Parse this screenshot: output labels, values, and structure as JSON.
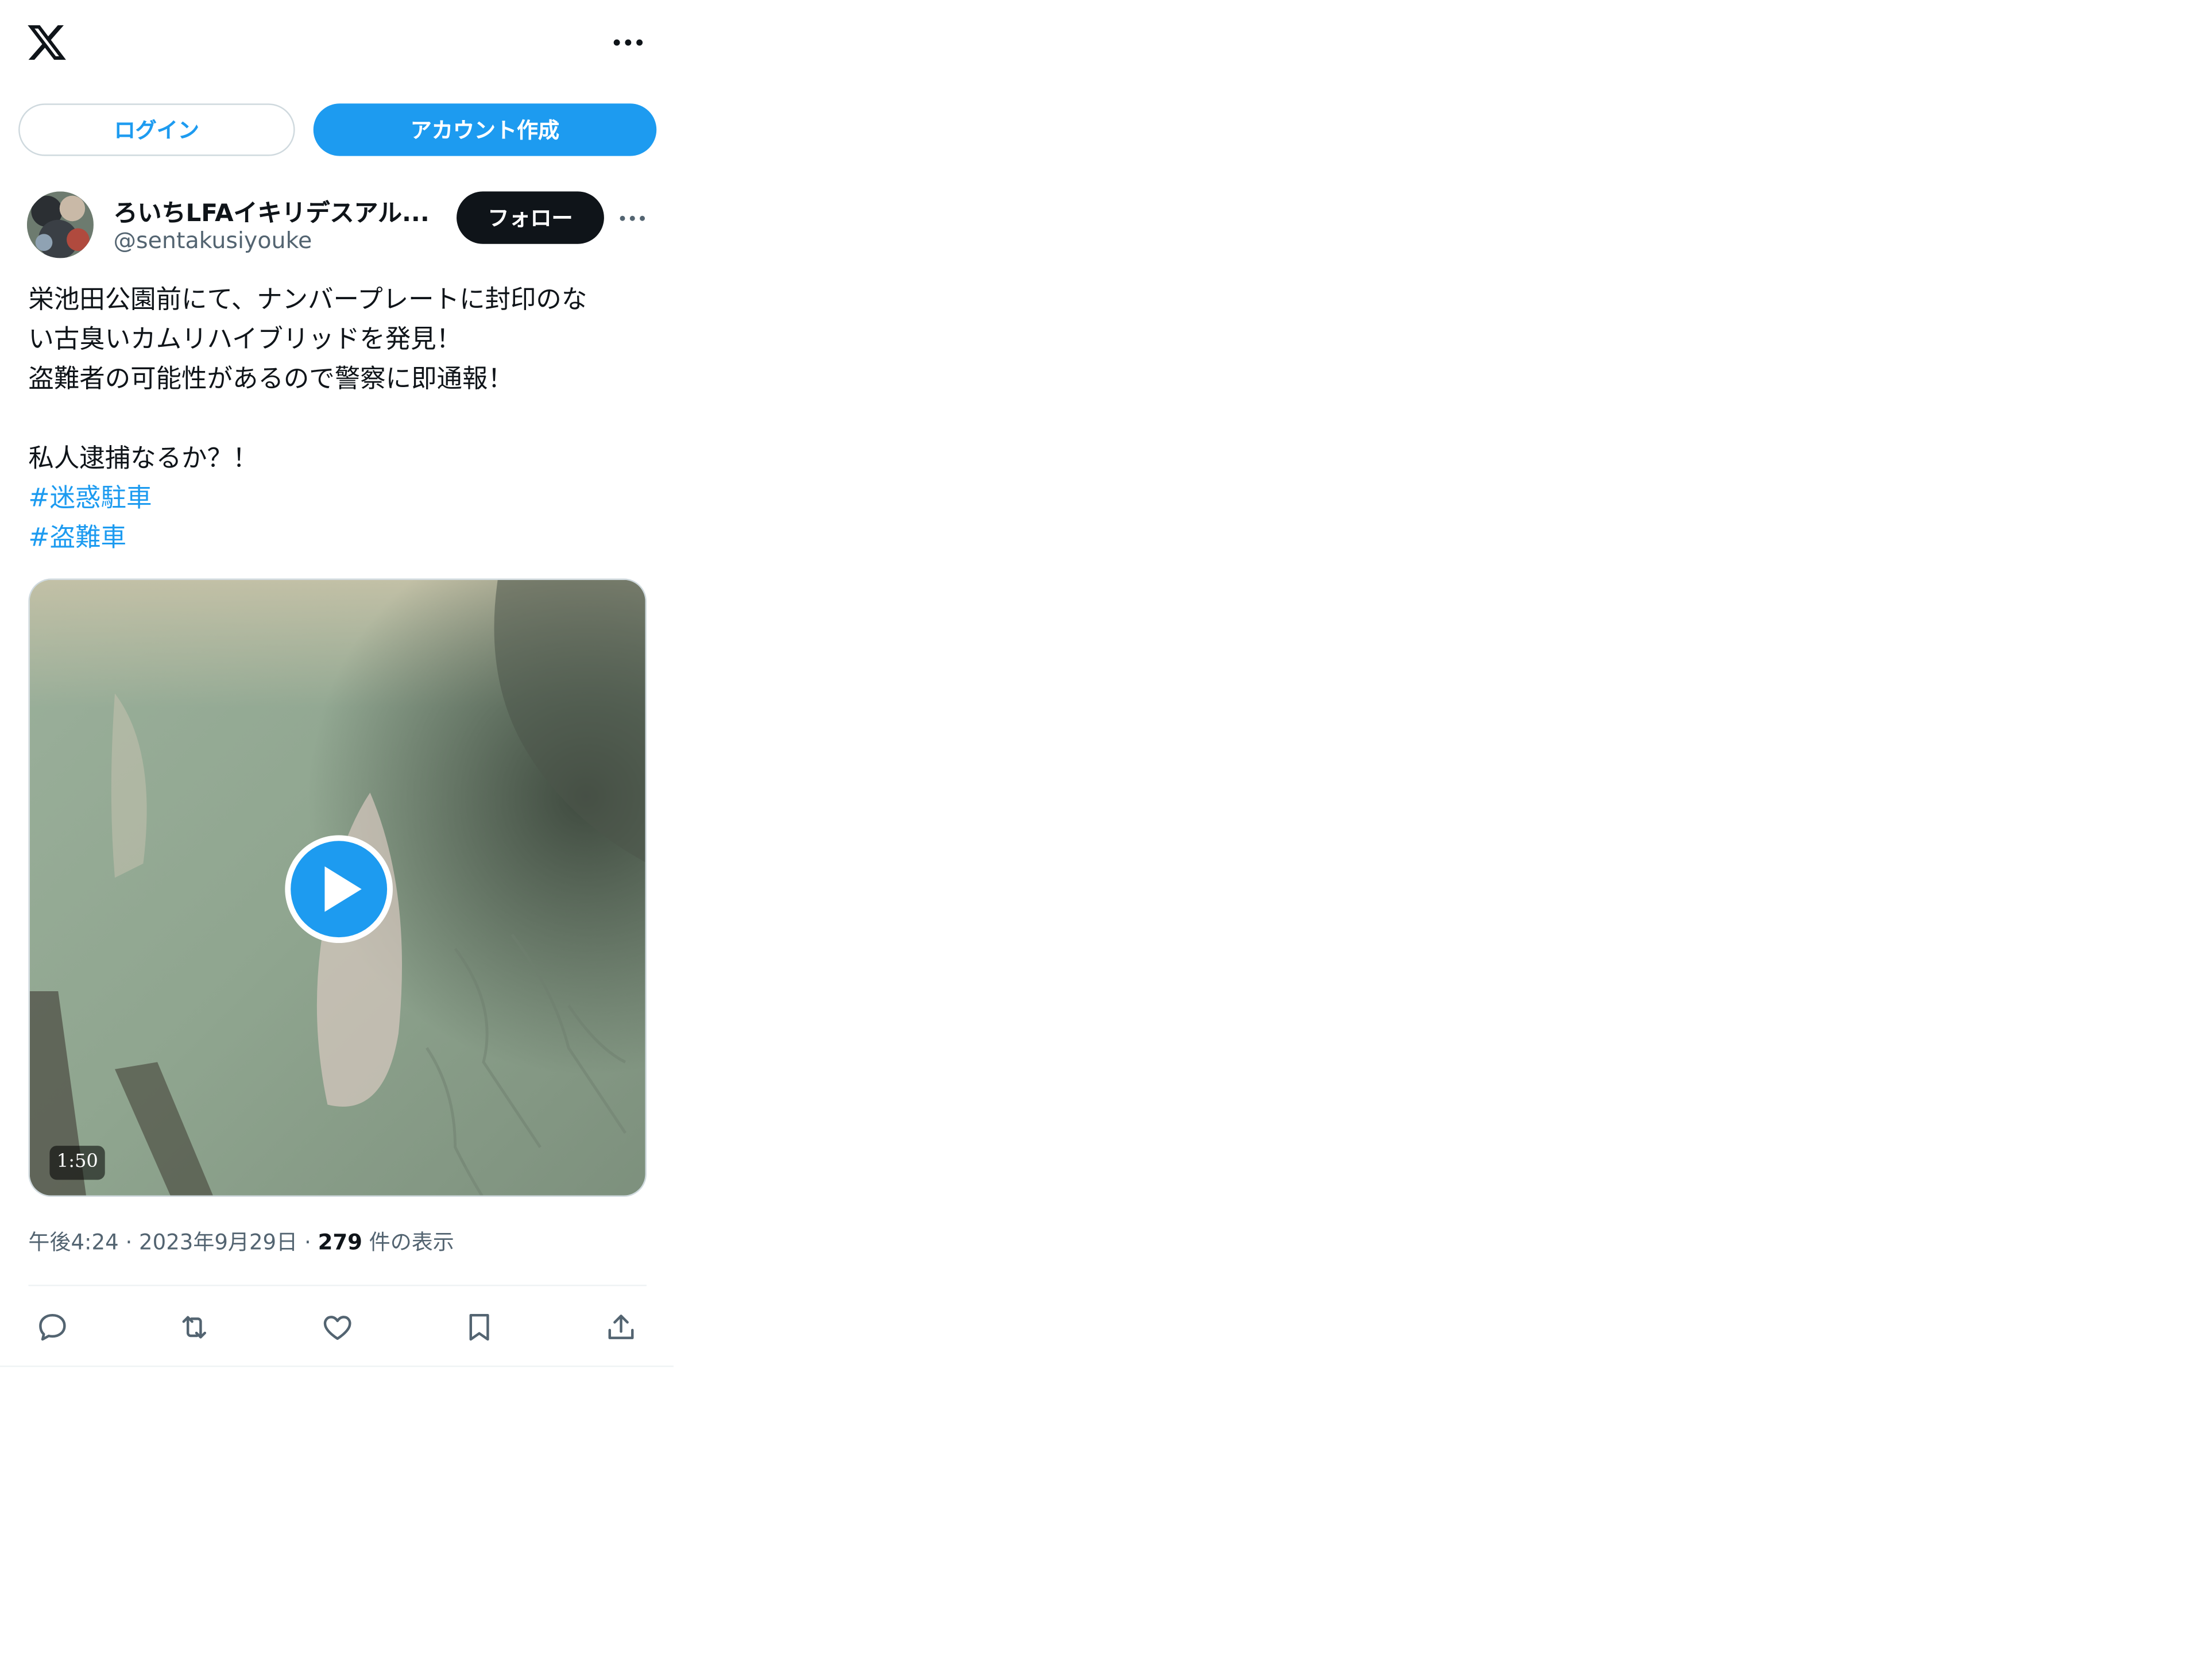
{
  "header": {
    "logo_icon": "x-logo-icon",
    "more_icon": "more-horizontal-icon"
  },
  "auth": {
    "login_label": "ログイン",
    "signup_label": "アカウント作成"
  },
  "post": {
    "author_name": "ろいちLFAイキリデスアル...",
    "author_handle": "@sentakusiyouke",
    "follow_label": "フォロー",
    "text_lines": [
      "栄池田公園前にて、ナンバープレートに封印のな",
      "い古臭いカムリハイブリッドを発見！",
      "盗難者の可能性があるので警察に即通報！",
      "",
      "私人逮捕なるか？！"
    ],
    "hashtags": [
      "#迷惑駐車",
      "#盗難車"
    ],
    "video": {
      "duration": "1:50",
      "play_icon": "play-icon"
    },
    "time": "午後4:24",
    "date": "2023年9月29日",
    "separator": "·",
    "view_count": "279",
    "view_label": "件の表示"
  },
  "actions": [
    "reply-icon",
    "repost-icon",
    "like-icon",
    "bookmark-icon",
    "share-icon"
  ],
  "colors": {
    "accent": "#1d9bf0",
    "text": "#0f1419",
    "secondary": "#536471"
  }
}
